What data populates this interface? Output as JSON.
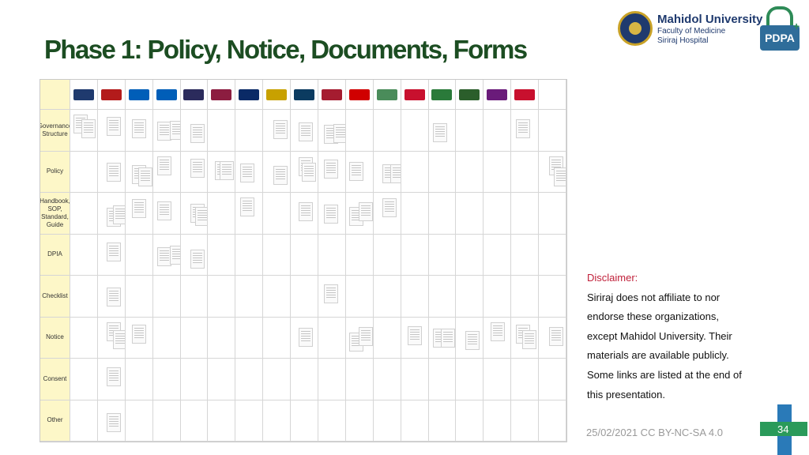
{
  "slide": {
    "title": "Phase 1: Policy, Notice, Documents, Forms",
    "brand": {
      "name": "Mahidol University",
      "sub1": "Faculty of Medicine",
      "sub2": "Siriraj Hospital"
    },
    "pdpa_label": "PDPA",
    "pdpa_plus": "+",
    "table": {
      "rows": [
        "Governance Structure",
        "Policy",
        "Handbook, SOP, Standard, Guide",
        "DPIA",
        "Checklist",
        "Notice",
        "Consent",
        "Other"
      ],
      "org_logo_icons": [
        "mahidol-logo-icon",
        "cambridge-logo-icon",
        "nhs-logo-icon",
        "nhs-trust-logo-icon",
        "crest-logo-icon",
        "edinburgh-logo-icon",
        "london-logo-icon",
        "columbia-logo-icon",
        "ucsf-logo-icon",
        "harvard-logo-icon",
        "red-cross-logo-icon",
        "hospital-seal-logo-icon",
        "bangkok-hospital-logo-icon",
        "shield-logo-icon",
        "university-logo-icon",
        "thai-airways-logo-icon",
        "exim-logo-icon",
        "blank-logo-icon"
      ],
      "logo_colors": [
        "#1f3a6e",
        "#b31b1b",
        "#005eb8",
        "#005eb8",
        "#2b2b5c",
        "#8c1d40",
        "#0a2a66",
        "#c8a100",
        "#0b3b60",
        "#a51c30",
        "#d00000",
        "#4a8c5a",
        "#c8102e",
        "#2a7a3a",
        "#2b5e2b",
        "#6a1b7a",
        "#c8102e",
        "#ffffff"
      ]
    },
    "disclaimer": {
      "heading": "Disclaimer:",
      "lines": [
        "Siriraj does not affiliate to nor",
        "endorse these organizations,",
        "except Mahidol University. Their",
        "materials are available publicly.",
        "Some links are listed at the end of",
        "this presentation."
      ]
    },
    "footer": "25/02/2021   CC BY-NC-SA 4.0",
    "page_number": "34"
  }
}
